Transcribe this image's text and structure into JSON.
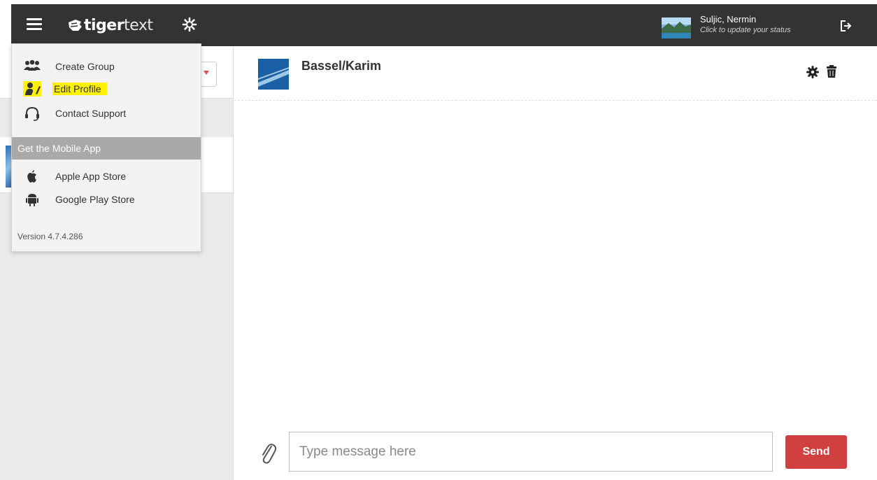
{
  "app": {
    "brand_bold": "tiger",
    "brand_light": "text"
  },
  "user": {
    "name": "Suljic, Nermin",
    "status": "Click to update your status"
  },
  "menu": {
    "items": [
      {
        "label": "Create Group",
        "icon": "group-icon"
      },
      {
        "label": "Edit Profile",
        "icon": "edit-profile-icon",
        "highlighted": true
      },
      {
        "label": "Contact Support",
        "icon": "headset-icon"
      }
    ],
    "section_title": "Get the Mobile App",
    "store_items": [
      {
        "label": "Apple App Store",
        "icon": "apple-icon"
      },
      {
        "label": "Google Play Store",
        "icon": "android-icon"
      }
    ],
    "version": "Version 4.7.4.286"
  },
  "chat": {
    "title": "Bassel/Karim"
  },
  "composer": {
    "placeholder": "Type message here",
    "value": "",
    "send_label": "Send"
  },
  "colors": {
    "header_bg": "#333333",
    "send_button": "#d04040",
    "highlight": "#fff200",
    "menu_section": "#a9a9a9"
  }
}
